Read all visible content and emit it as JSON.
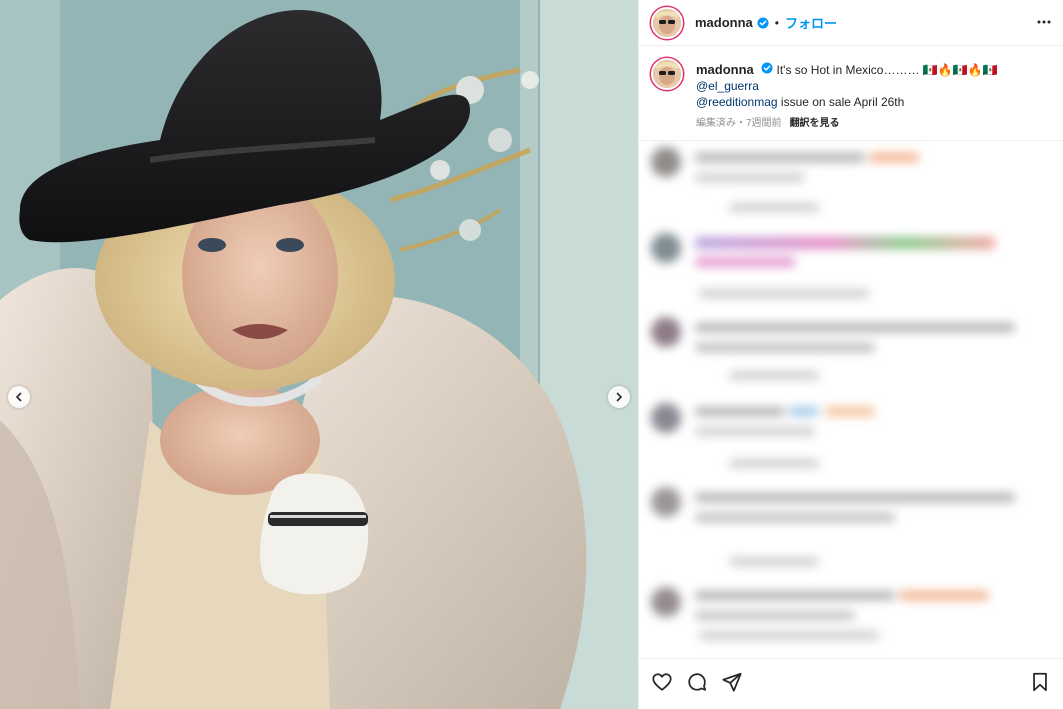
{
  "post": {
    "username": "madonna",
    "verified": true,
    "separator": "•",
    "follow_label": "フォロー",
    "caption": {
      "text": "It's so Hot in Mexico……… 🇲🇽🔥🇲🇽🔥🇲🇽",
      "mention_1": "@el_guerra",
      "mention_2": "@reeditionmag",
      "after_mention_2": " issue on sale April 26th"
    },
    "meta": {
      "edited_time": "編集済み・7週間前",
      "translate_label": "翻訳を見る"
    }
  },
  "icons": {
    "more": "more-options-icon",
    "prev": "chevron-left-icon",
    "next": "chevron-right-icon",
    "like": "heart-icon",
    "comment": "comment-icon",
    "share": "paper-plane-icon",
    "save": "bookmark-icon"
  },
  "colors": {
    "accent": "#0095f6",
    "mention": "#00376b",
    "meta": "#8e8e8e"
  }
}
